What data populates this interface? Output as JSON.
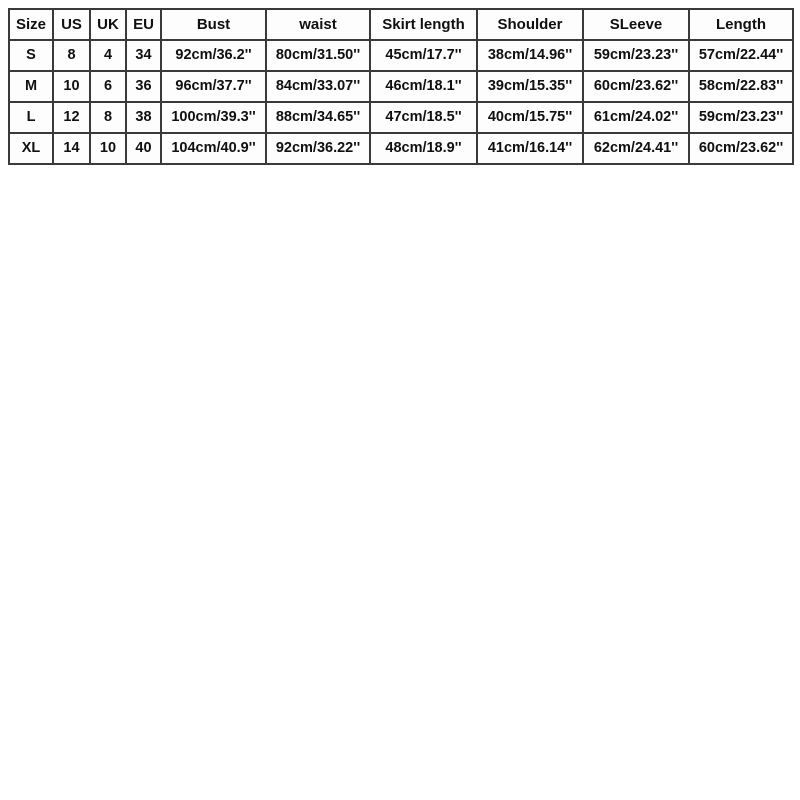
{
  "document": {
    "type": "size-chart-table",
    "background_color": "#ffffff",
    "border_color": "#3a3a3a",
    "text_color": "#101010",
    "cell_background": "#fdfdfd"
  },
  "table": {
    "columns": [
      {
        "key": "size",
        "label": "Size"
      },
      {
        "key": "us",
        "label": "US"
      },
      {
        "key": "uk",
        "label": "UK"
      },
      {
        "key": "eu",
        "label": "EU"
      },
      {
        "key": "bust",
        "label": "Bust"
      },
      {
        "key": "waist",
        "label": "waist"
      },
      {
        "key": "skirt",
        "label": "Skirt length"
      },
      {
        "key": "shoulder",
        "label": "Shoulder"
      },
      {
        "key": "sleeve",
        "label": "SLeeve"
      },
      {
        "key": "length",
        "label": "Length"
      }
    ],
    "rows": [
      {
        "size": "S",
        "us": "8",
        "uk": "4",
        "eu": "34",
        "bust": "92cm/36.2''",
        "waist": "80cm/31.50''",
        "skirt": "45cm/17.7''",
        "shoulder": "38cm/14.96''",
        "sleeve": "59cm/23.23''",
        "length": "57cm/22.44''"
      },
      {
        "size": "M",
        "us": "10",
        "uk": "6",
        "eu": "36",
        "bust": "96cm/37.7''",
        "waist": "84cm/33.07''",
        "skirt": "46cm/18.1''",
        "shoulder": "39cm/15.35''",
        "sleeve": "60cm/23.62''",
        "length": "58cm/22.83''"
      },
      {
        "size": "L",
        "us": "12",
        "uk": "8",
        "eu": "38",
        "bust": "100cm/39.3''",
        "waist": "88cm/34.65''",
        "skirt": "47cm/18.5''",
        "shoulder": "40cm/15.75''",
        "sleeve": "61cm/24.02''",
        "length": "59cm/23.23''"
      },
      {
        "size": "XL",
        "us": "14",
        "uk": "10",
        "eu": "40",
        "bust": "104cm/40.9''",
        "waist": "92cm/36.22''",
        "skirt": "48cm/18.9''",
        "shoulder": "41cm/16.14''",
        "sleeve": "62cm/24.41''",
        "length": "60cm/23.62''"
      }
    ]
  }
}
